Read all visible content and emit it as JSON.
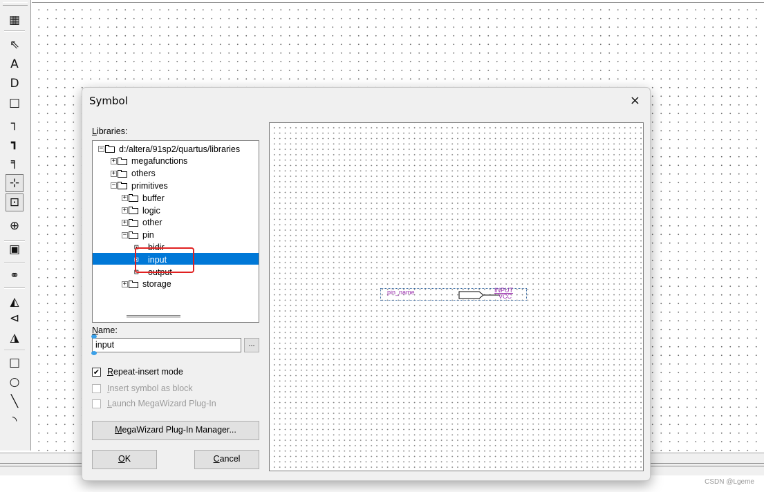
{
  "toolbar": {
    "buttons": [
      {
        "name": "symbol-tool",
        "glyph": "▦"
      },
      {
        "name": "selection-tool",
        "glyph": "⇖"
      },
      {
        "name": "text-tool",
        "glyph": "A"
      },
      {
        "name": "symbol-insert-tool",
        "glyph": "D"
      },
      {
        "name": "block-tool",
        "glyph": "□"
      },
      {
        "name": "orthogonal-node-tool",
        "glyph": "┐"
      },
      {
        "name": "orthogonal-bus-tool",
        "glyph": "┓"
      },
      {
        "name": "orthogonal-conduit-tool",
        "glyph": "╕"
      },
      {
        "name": "rubberbanding-tool",
        "glyph": "⊹"
      },
      {
        "name": "partial-line-selection-tool",
        "glyph": "⊡"
      },
      {
        "name": "zoom-tool",
        "glyph": "⊕"
      },
      {
        "name": "full-screen-tool",
        "glyph": "▣"
      },
      {
        "name": "find-tool",
        "glyph": "⚭"
      },
      {
        "name": "flip-horizontal-tool",
        "glyph": "◭"
      },
      {
        "name": "flip-vertical-tool",
        "glyph": "⊲"
      },
      {
        "name": "rotate-tool",
        "glyph": "◮"
      },
      {
        "name": "rectangle-tool",
        "glyph": "□"
      },
      {
        "name": "oval-tool",
        "glyph": "○"
      },
      {
        "name": "line-tool",
        "glyph": "╲"
      },
      {
        "name": "arc-tool",
        "glyph": "◝"
      }
    ]
  },
  "dialog": {
    "title": "Symbol",
    "close": "×",
    "libraries_label_accel": "L",
    "libraries_label_rest": "ibraries:",
    "tree": [
      {
        "label": "d:/altera/91sp2/quartus/libraries",
        "exp": "−",
        "kind": "folder"
      },
      {
        "label": "megafunctions",
        "exp": "+",
        "kind": "folder"
      },
      {
        "label": "others",
        "exp": "+",
        "kind": "folder"
      },
      {
        "label": "primitives",
        "exp": "−",
        "kind": "folder"
      },
      {
        "label": "buffer",
        "exp": "+",
        "kind": "folder"
      },
      {
        "label": "logic",
        "exp": "+",
        "kind": "folder"
      },
      {
        "label": "other",
        "exp": "+",
        "kind": "folder"
      },
      {
        "label": "pin",
        "exp": "−",
        "kind": "folder"
      },
      {
        "label": "bidir",
        "exp": "",
        "kind": "pin"
      },
      {
        "label": "input",
        "exp": "",
        "kind": "pin",
        "selected": true
      },
      {
        "label": "output",
        "exp": "",
        "kind": "pin"
      },
      {
        "label": "storage",
        "exp": "+",
        "kind": "folder"
      }
    ],
    "name_label_accel": "N",
    "name_label_rest": "ame:",
    "name_value": "input",
    "browse": "...",
    "repeat_accel": "R",
    "repeat_rest": "epeat-insert mode",
    "repeat_checked": "✔",
    "insert_block_accel": "I",
    "insert_block_rest": "nsert symbol as block",
    "launch_accel": "L",
    "launch_rest": "aunch MegaWizard Plug-In",
    "megawizard_accel": "M",
    "megawizard_rest": "egaWizard Plug-In Manager...",
    "ok_accel": "O",
    "ok_rest": "K",
    "cancel_accel": "C",
    "cancel_rest": "ancel",
    "preview": {
      "pin_name": "pin_name",
      "type": "INPUT",
      "vcc": "VCC"
    }
  },
  "watermark": "CSDN @Lgeme",
  "colors": {
    "selection": "#0078d7",
    "highlight": "#e02020",
    "symbol_text": "#9b30ae"
  }
}
